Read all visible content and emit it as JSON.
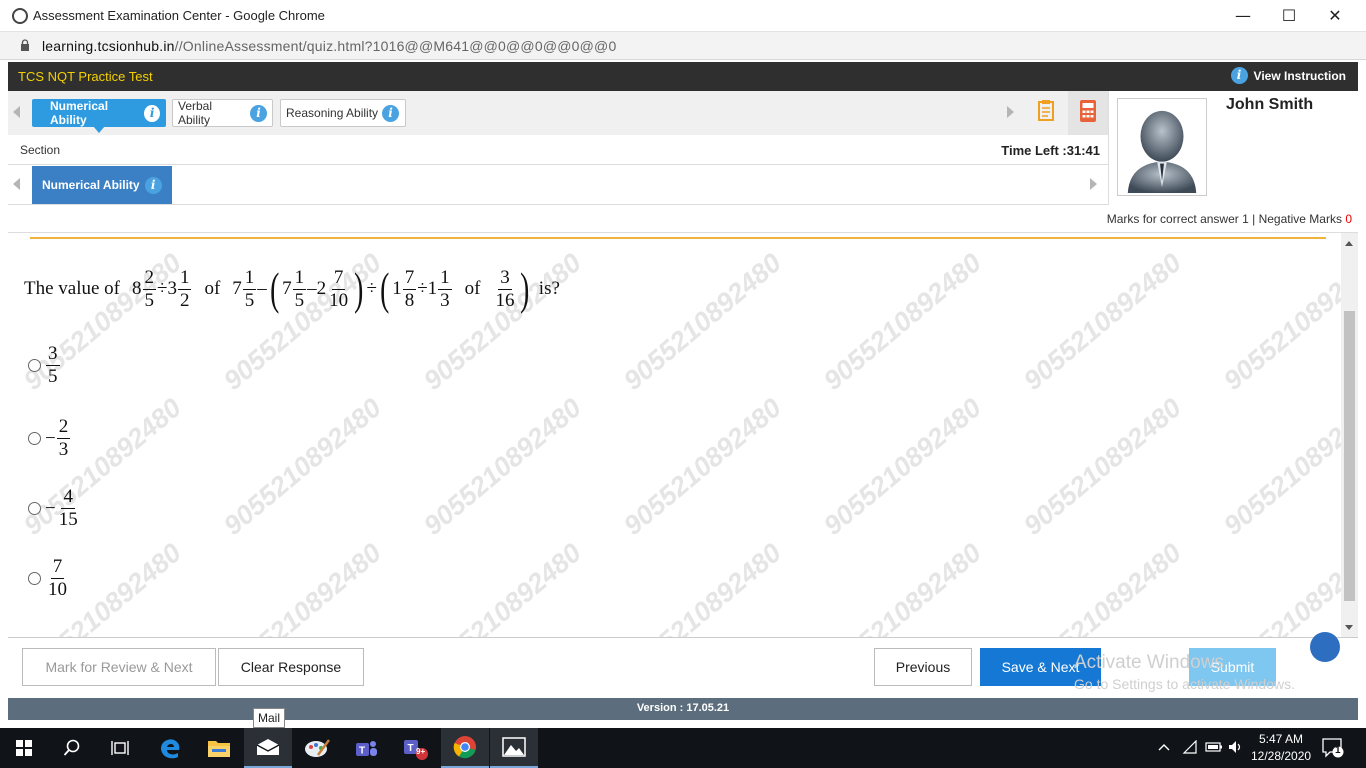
{
  "browser": {
    "window_title": "Assessment Examination Center - Google Chrome",
    "url_host": "learning.tcsionhub.in",
    "url_path": "//OnlineAssessment/quiz.html?1016@@M641@@0@@0@@0@@0"
  },
  "app": {
    "test_name": "TCS NQT Practice Test",
    "view_instruction": "View Instruction",
    "info_glyph": "i"
  },
  "sections": {
    "tabs": [
      {
        "label": "Numerical Ability",
        "active": true
      },
      {
        "label": "Verbal Ability",
        "active": false
      },
      {
        "label": "Reasoning Ability",
        "active": false
      }
    ],
    "section_label": "Section",
    "time_left": "Time Left :31:41",
    "current_subsection": "Numerical Ability"
  },
  "candidate": {
    "name": "John Smith"
  },
  "marks": {
    "prefix": "Marks for correct answer",
    "correct": "1",
    "separator": "|",
    "negative_label": "Negative Marks",
    "negative": "0"
  },
  "question": {
    "intro": "The value of",
    "t1_whole": "8",
    "t1_n": "2",
    "t1_d": "5",
    "div": "÷",
    "t2_whole": "3",
    "t2_n": "1",
    "t2_d": "2",
    "of": "of",
    "t3_whole": "7",
    "t3_n": "1",
    "t3_d": "5",
    "minus": "–",
    "t4_whole": "7",
    "t4_n": "1",
    "t4_d": "5",
    "t5_whole": "2",
    "t5_n": "7",
    "t5_d": "10",
    "t6_whole": "1",
    "t6_n": "7",
    "t6_d": "8",
    "t7_whole": "1",
    "t7_n": "1",
    "t7_d": "3",
    "t8_n": "3",
    "t8_d": "16",
    "suffix": "is?",
    "lparen": "(",
    "rparen": ")"
  },
  "options": [
    {
      "sign": "",
      "num": "3",
      "den": "5"
    },
    {
      "sign": "−",
      "num": "2",
      "den": "3"
    },
    {
      "sign": "−",
      "num": "4",
      "den": "15"
    },
    {
      "sign": "",
      "num": "7",
      "den": "10"
    }
  ],
  "watermark": "905521089248 0",
  "watermark_text": "9055210892480",
  "buttons": {
    "mark_review": "Mark for Review & Next",
    "clear": "Clear Response",
    "previous": "Previous",
    "save_next": "Save & Next",
    "submit": "Submit"
  },
  "windows_activation": {
    "title": "Activate Windows",
    "subtitle": "Go to Settings to activate Windows."
  },
  "version": "Version : 17.05.21",
  "taskbar": {
    "tooltip": "Mail",
    "badge": "9+",
    "time": "5:47 AM",
    "date": "12/28/2020",
    "notifications": "1"
  },
  "colors": {
    "accent_blue": "#2e9be0",
    "test_name_yellow": "#f4d000",
    "save_next_blue": "#1478d4"
  }
}
